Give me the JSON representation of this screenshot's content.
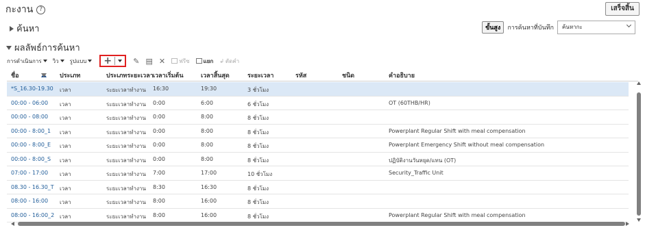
{
  "header": {
    "title": "กะงาน",
    "done_label": "เสร็จสิ้น"
  },
  "search": {
    "section_label": "ค้นหา",
    "advanced_label": "ขั้นสูง",
    "saved_search_label": "การค้นหาที่บันทึก",
    "saved_search_value": "ค้นหากะ"
  },
  "results": {
    "section_label": "ผลลัพธ์การค้นหา"
  },
  "toolbar": {
    "actions_label": "การดำเนินการ",
    "view_label": "วิว",
    "format_label": "รูปแบบ",
    "freeze_label": "ฟรีซ",
    "detach_label": "แยก",
    "wrap_label": "ตัดคำ"
  },
  "table": {
    "columns": [
      "ชื่อ",
      "ประเภท",
      "ประเภทระยะเวลา",
      "เวลาเริ่มต้น",
      "เวลาสิ้นสุด",
      "ระยะเวลา",
      "รหัส",
      "ชนิด",
      "คำอธิบาย"
    ],
    "rows": [
      {
        "name": "*S_16.30-19.30",
        "type": "เวลา",
        "duration_type": "ระยะเวลาทำงาน",
        "start": "16:30",
        "end": "19:30",
        "duration": "3  ชั่วโมง",
        "code": "",
        "kind": "",
        "desc": ""
      },
      {
        "name": "00:00 - 06:00",
        "type": "เวลา",
        "duration_type": "ระยะเวลาทำงาน",
        "start": "0:00",
        "end": "6:00",
        "duration": "6  ชั่วโมง",
        "code": "",
        "kind": "",
        "desc": "OT (60THB/HR)"
      },
      {
        "name": "00:00 - 08:00",
        "type": "เวลา",
        "duration_type": "ระยะเวลาทำงาน",
        "start": "0:00",
        "end": "8:00",
        "duration": "8  ชั่วโมง",
        "code": "",
        "kind": "",
        "desc": ""
      },
      {
        "name": "00:00 - 8:00_1",
        "type": "เวลา",
        "duration_type": "ระยะเวลาทำงาน",
        "start": "0:00",
        "end": "8:00",
        "duration": "8  ชั่วโมง",
        "code": "",
        "kind": "",
        "desc": "Powerplant Regular Shift with meal compensation"
      },
      {
        "name": "00:00 - 8:00_E",
        "type": "เวลา",
        "duration_type": "ระยะเวลาทำงาน",
        "start": "0:00",
        "end": "8:00",
        "duration": "8  ชั่วโมง",
        "code": "",
        "kind": "",
        "desc": "Powerplant Emergency Shift without meal compensation"
      },
      {
        "name": "00:00 - 8:00_S",
        "type": "เวลา",
        "duration_type": "ระยะเวลาทำงาน",
        "start": "0:00",
        "end": "8:00",
        "duration": "8  ชั่วโมง",
        "code": "",
        "kind": "",
        "desc": "ปฏิบัติงานวันหยุด/แทน (OT)"
      },
      {
        "name": "07:00 - 17:00",
        "type": "เวลา",
        "duration_type": "ระยะเวลาทำงาน",
        "start": "7:00",
        "end": "17:00",
        "duration": "10  ชั่วโมง",
        "code": "",
        "kind": "",
        "desc": "Security_Traffic Unit"
      },
      {
        "name": "08.30 - 16.30_T",
        "type": "เวลา",
        "duration_type": "ระยะเวลาทำงาน",
        "start": "8:30",
        "end": "16:30",
        "duration": "8  ชั่วโมง",
        "code": "",
        "kind": "",
        "desc": ""
      },
      {
        "name": "08:00 - 16:00",
        "type": "เวลา",
        "duration_type": "ระยะเวลาทำงาน",
        "start": "8:00",
        "end": "16:00",
        "duration": "8  ชั่วโมง",
        "code": "",
        "kind": "",
        "desc": ""
      },
      {
        "name": "08:00 - 16:00_2",
        "type": "เวลา",
        "duration_type": "ระยะเวลาทำงาน",
        "start": "8:00",
        "end": "16:00",
        "duration": "8  ชั่วโมง",
        "code": "",
        "kind": "",
        "desc": "Powerplant Regular Shift with meal compensation"
      }
    ]
  },
  "colors": {
    "link": "#1f5c99",
    "selected_row": "#dbe8f6",
    "highlight_border": "#e01f1f"
  }
}
